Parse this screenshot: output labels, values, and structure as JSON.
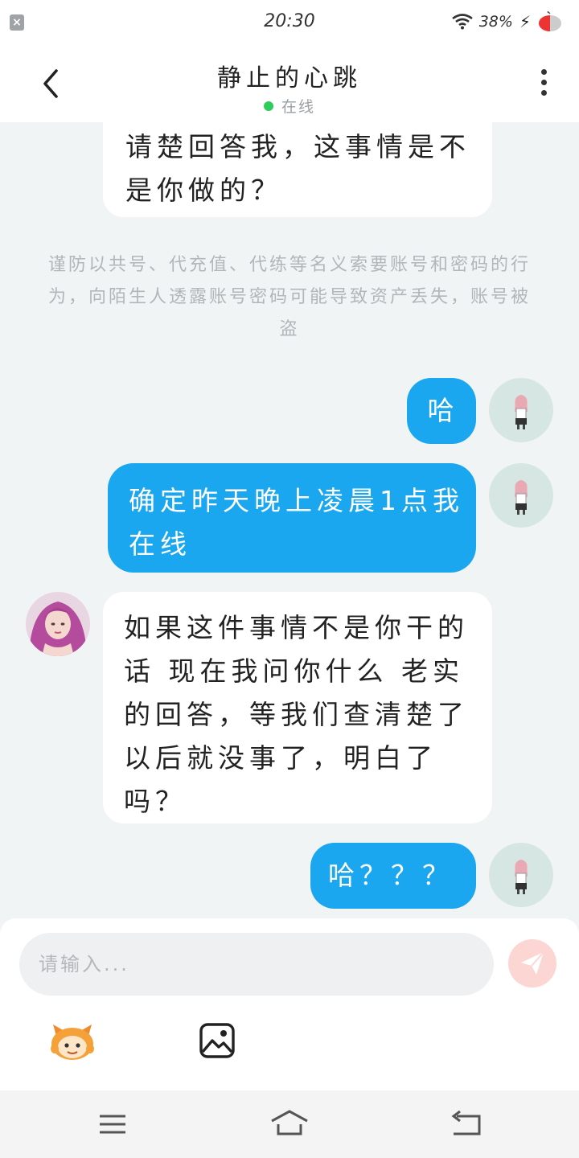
{
  "status_bar": {
    "time": "20:30",
    "battery": "38%"
  },
  "header": {
    "title": "静止的心跳",
    "status": "在线"
  },
  "messages": {
    "m1": {
      "lines": [
        "请楚回答我，这事情是不",
        "是你做的？"
      ]
    },
    "notice": "谨防以共号、代充值、代练等名义索要账号和密码的行为，向陌生人透露账号密码可能导致资产丢失，账号被盗",
    "m2": {
      "text": "哈"
    },
    "m3": {
      "lines": [
        "确定昨天晚上凌晨1点我",
        "在线"
      ]
    },
    "m4": {
      "lines": [
        "如果这件事情不是你干的",
        "话 现在我问你什么 老实",
        "的回答，等我们查清楚了",
        "以后就没事了，明白了",
        "吗？"
      ]
    },
    "m5": {
      "text": "哈？？？"
    }
  },
  "input": {
    "placeholder": "请输入..."
  },
  "colors": {
    "outgoing": "#1aa7f0",
    "incoming": "#ffffff",
    "online": "#2ecc5a",
    "send": "#fbd6d3"
  },
  "icons": [
    "close-icon",
    "wifi-icon",
    "bolt-icon",
    "battery-icon",
    "back-arrow-icon",
    "more-dots-icon",
    "send-icon",
    "emoji-icon",
    "image-icon",
    "menu-icon",
    "home-icon",
    "return-icon"
  ]
}
